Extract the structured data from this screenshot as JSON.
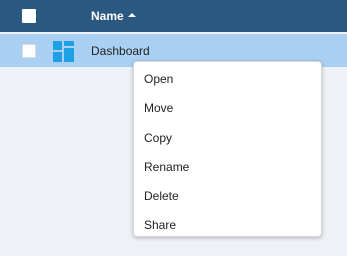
{
  "header": {
    "name_label": "Name",
    "second_col_label": "",
    "sort_direction": "ascending"
  },
  "rows": [
    {
      "label": "Dashboard",
      "icon": "dashboard-icon",
      "selected": true,
      "second_col": ""
    }
  ],
  "context_menu": {
    "items": [
      "Open",
      "Move",
      "Copy",
      "Rename",
      "Delete",
      "Share"
    ]
  },
  "colors": {
    "header_bg": "#2b5880",
    "selected_row_bg": "#a9d0f2",
    "icon_accent": "#1ea0e6",
    "page_bg": "#eef1f5"
  }
}
